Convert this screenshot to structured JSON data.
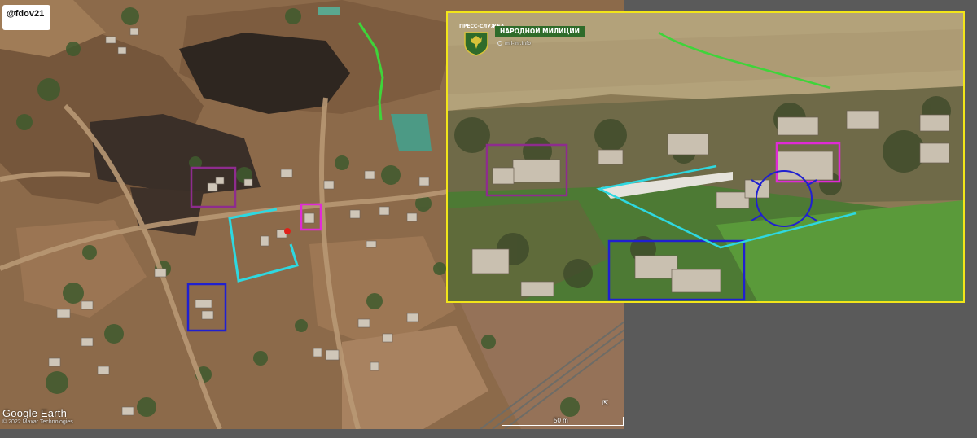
{
  "satellite": {
    "handle": "@fdov21",
    "logo_text": "Google Earth",
    "copyright": "© 2022 Maxar Technologies",
    "scale_label": "50 m",
    "compass_icon": "north-arrow-icon"
  },
  "aerial_inset": {
    "press_label": "ПРЕСС-СЛУЖБА",
    "unit_name": "НАРОДНОЙ МИЛИЦИИ",
    "site": "mil-lnr.info",
    "emblem_icon": "double-headed-eagle-emblem-icon"
  },
  "colors": {
    "background": "#5a5a5a",
    "inset_frame": "#f2e51a",
    "marker_green": "#3fd43a",
    "marker_purple": "#8e2c8e",
    "marker_magenta": "#e02ad6",
    "marker_blue": "#2020d0",
    "marker_cyan": "#2ed8e0",
    "marker_red": "#e0201a"
  }
}
